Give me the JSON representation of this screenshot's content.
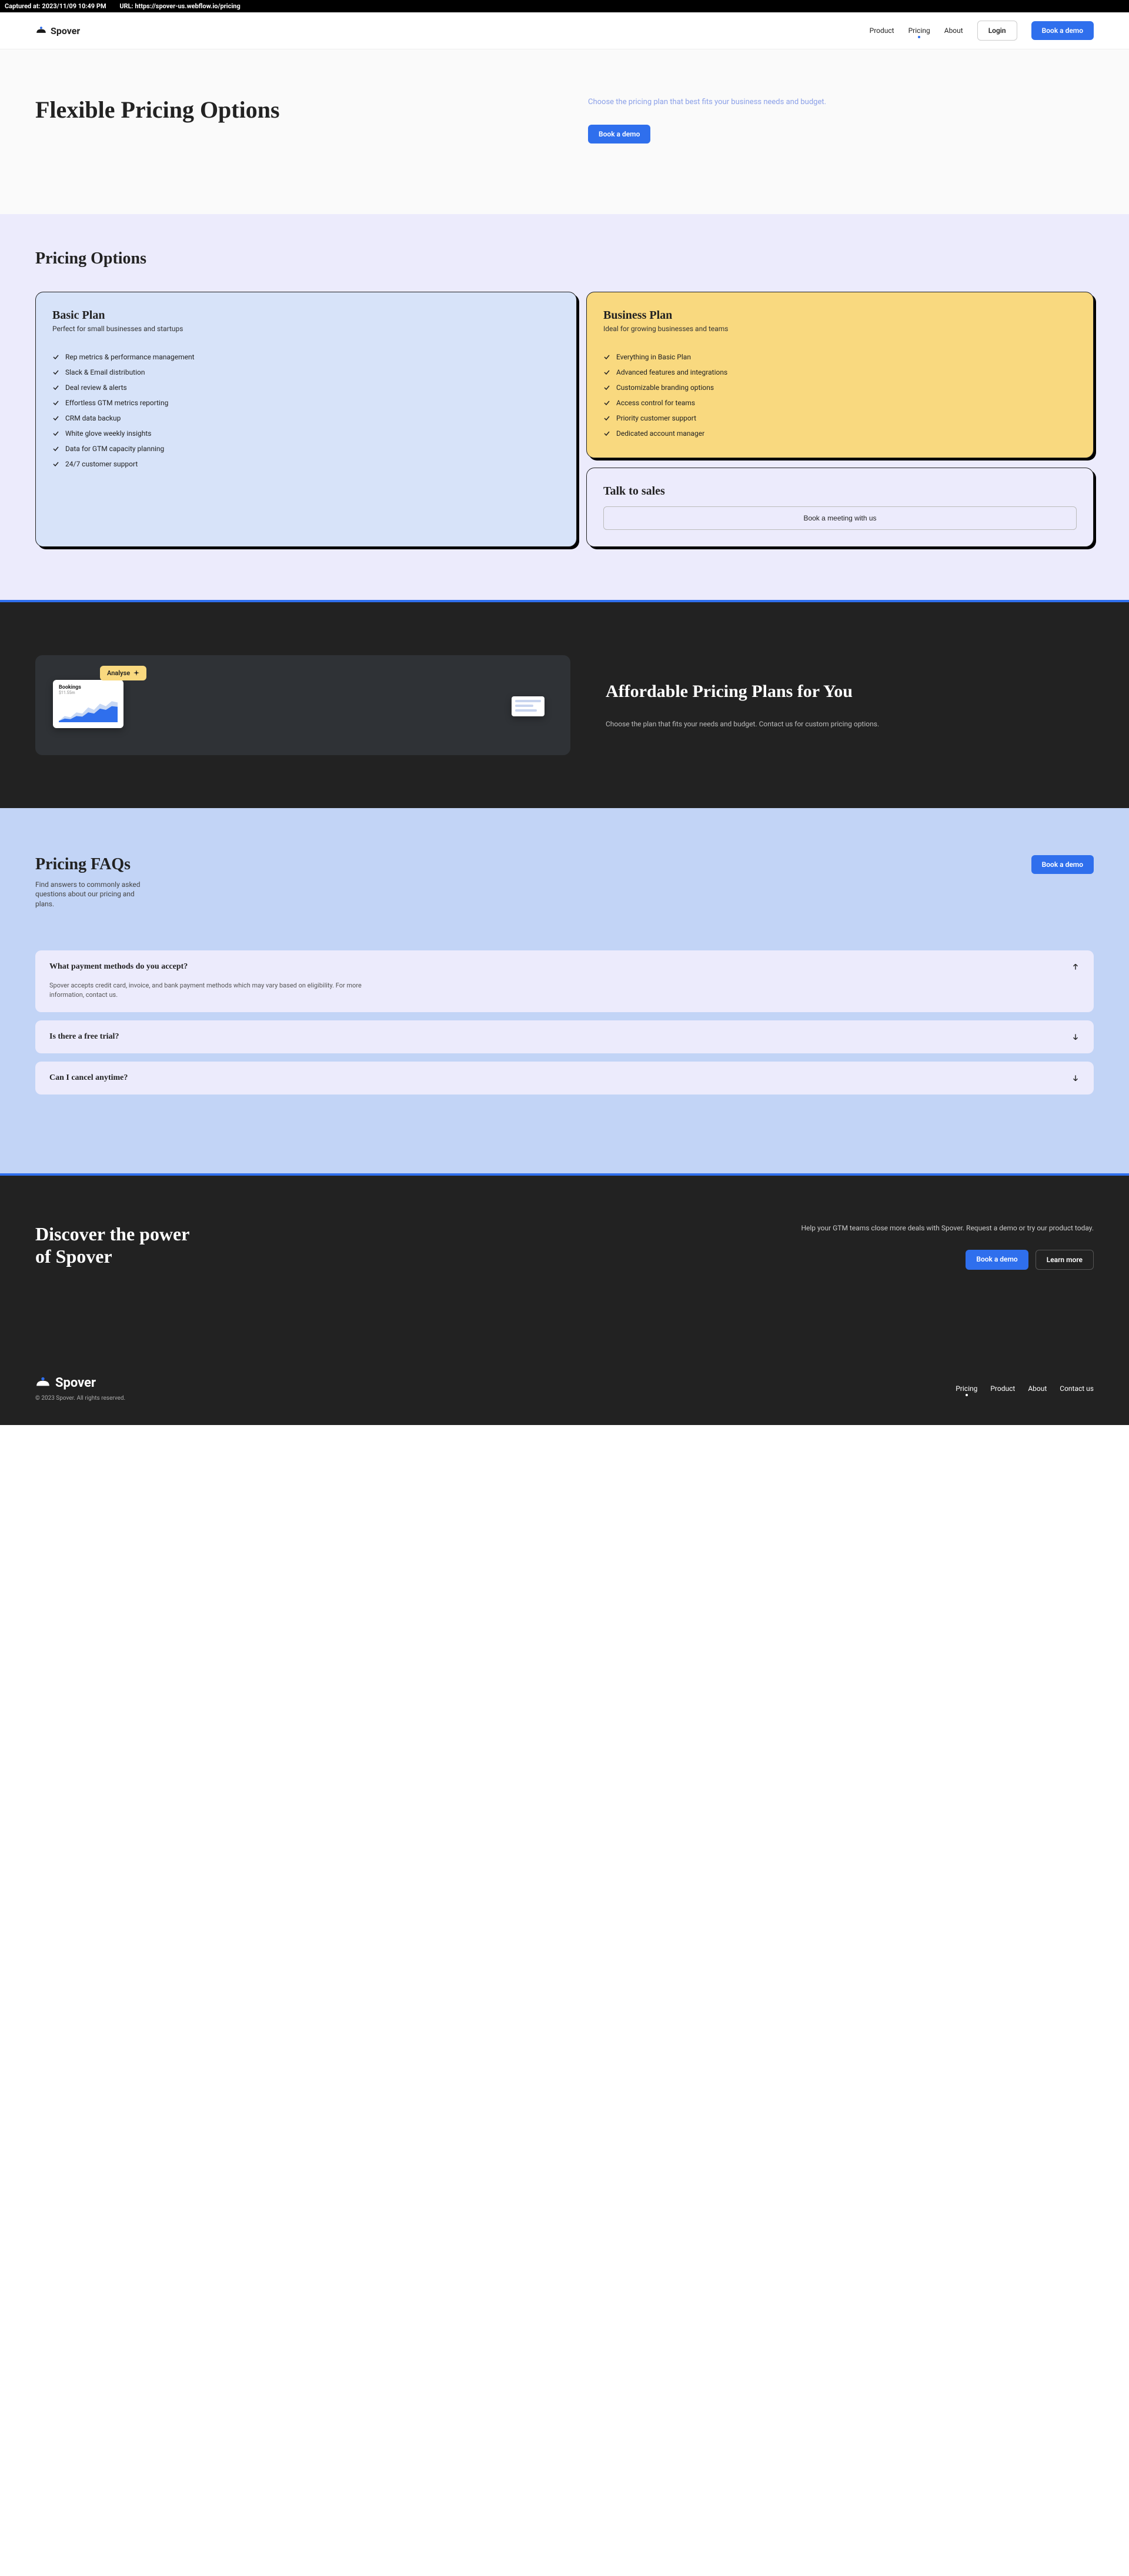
{
  "capture": {
    "time": "Captured at: 2023/11/09 10:49 PM",
    "url": "URL: https://spover-us.webflow.io/pricing"
  },
  "brand": "Spover",
  "nav": {
    "links": [
      "Product",
      "Pricing",
      "About"
    ],
    "login": "Login",
    "cta": "Book a demo"
  },
  "hero": {
    "title": "Flexible Pricing Options",
    "subtitle": "Choose the pricing plan that best fits your business needs and budget.",
    "cta": "Book a demo"
  },
  "pricing": {
    "title": "Pricing Options",
    "basic": {
      "name": "Basic Plan",
      "sub": "Perfect for small businesses and startups",
      "features": [
        "Rep metrics & performance management",
        "Slack & Email distribution",
        "Deal review & alerts",
        "Effortless GTM metrics reporting",
        "CRM data backup",
        "White glove weekly insights",
        "Data for GTM capacity planning",
        "24/7 customer support"
      ]
    },
    "business": {
      "name": "Business Plan",
      "sub": "Ideal for growing businesses and teams",
      "features": [
        "Everything in Basic Plan",
        "Advanced features and integrations",
        "Customizable branding options",
        "Access control for teams",
        "Priority customer support",
        "Dedicated account manager"
      ]
    },
    "sales": {
      "title": "Talk to sales",
      "cta": "Book a meeting with us"
    }
  },
  "dark": {
    "analyse": "Analyse",
    "bookings_title": "Bookings",
    "bookings_value": "$11.55m",
    "title": "Affordable Pricing Plans for You",
    "body": "Choose the plan that fits your needs and budget. Contact us for custom pricing options."
  },
  "faq": {
    "title": "Pricing FAQs",
    "sub": "Find answers to commonly asked questions about our pricing and plans.",
    "cta": "Book a demo",
    "items": [
      {
        "q": "What payment methods do you accept?",
        "a": "Spover accepts credit card, invoice, and bank payment methods which may vary based on eligibility. For more information, contact us.",
        "open": true
      },
      {
        "q": "Is there a free trial?",
        "open": false
      },
      {
        "q": "Can I cancel anytime?",
        "open": false
      }
    ]
  },
  "cta2": {
    "title": "Discover the power of Spover",
    "body": "Help your GTM teams close more deals with Spover. Request a demo or try our product today.",
    "primary": "Book a demo",
    "secondary": "Learn more"
  },
  "footer": {
    "copy": "© 2023 Spover. All rights reserved.",
    "links": [
      "Pricing",
      "Product",
      "About",
      "Contact us"
    ]
  }
}
